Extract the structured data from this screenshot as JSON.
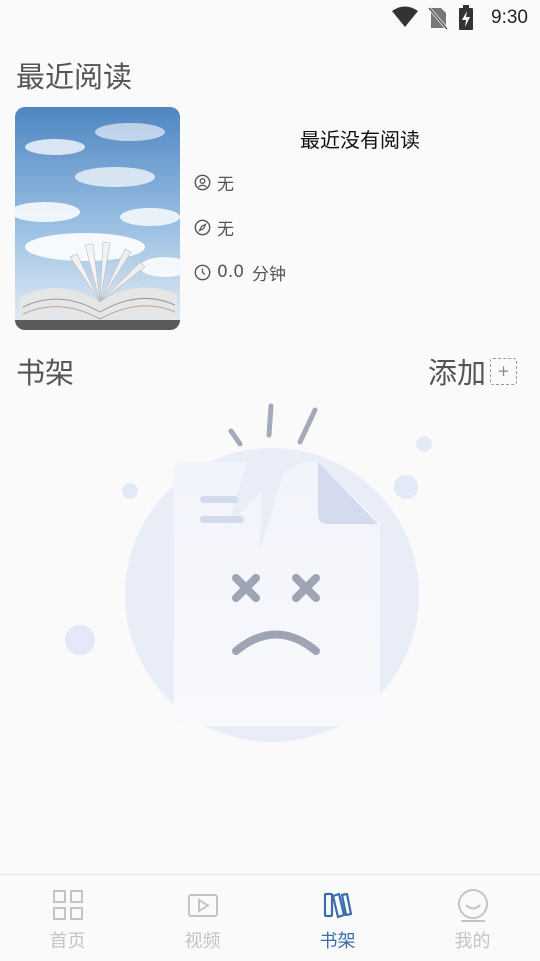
{
  "status_bar": {
    "time": "9:30"
  },
  "recent": {
    "title": "最近阅读",
    "book_title": "最近没有阅读",
    "author": "无",
    "source": "无",
    "duration_value": "0.0",
    "duration_unit": "分钟"
  },
  "shelf": {
    "title": "书架",
    "add_label": "添加",
    "add_symbol": "+"
  },
  "nav": [
    {
      "label": "首页",
      "icon": "grid-icon",
      "active": false
    },
    {
      "label": "视频",
      "icon": "video-icon",
      "active": false
    },
    {
      "label": "书架",
      "icon": "bookshelf-icon",
      "active": true
    },
    {
      "label": "我的",
      "icon": "smile-icon",
      "active": false
    }
  ],
  "colors": {
    "accent": "#3b6ea8",
    "inactive": "#c4c4c4",
    "text": "#555555"
  }
}
